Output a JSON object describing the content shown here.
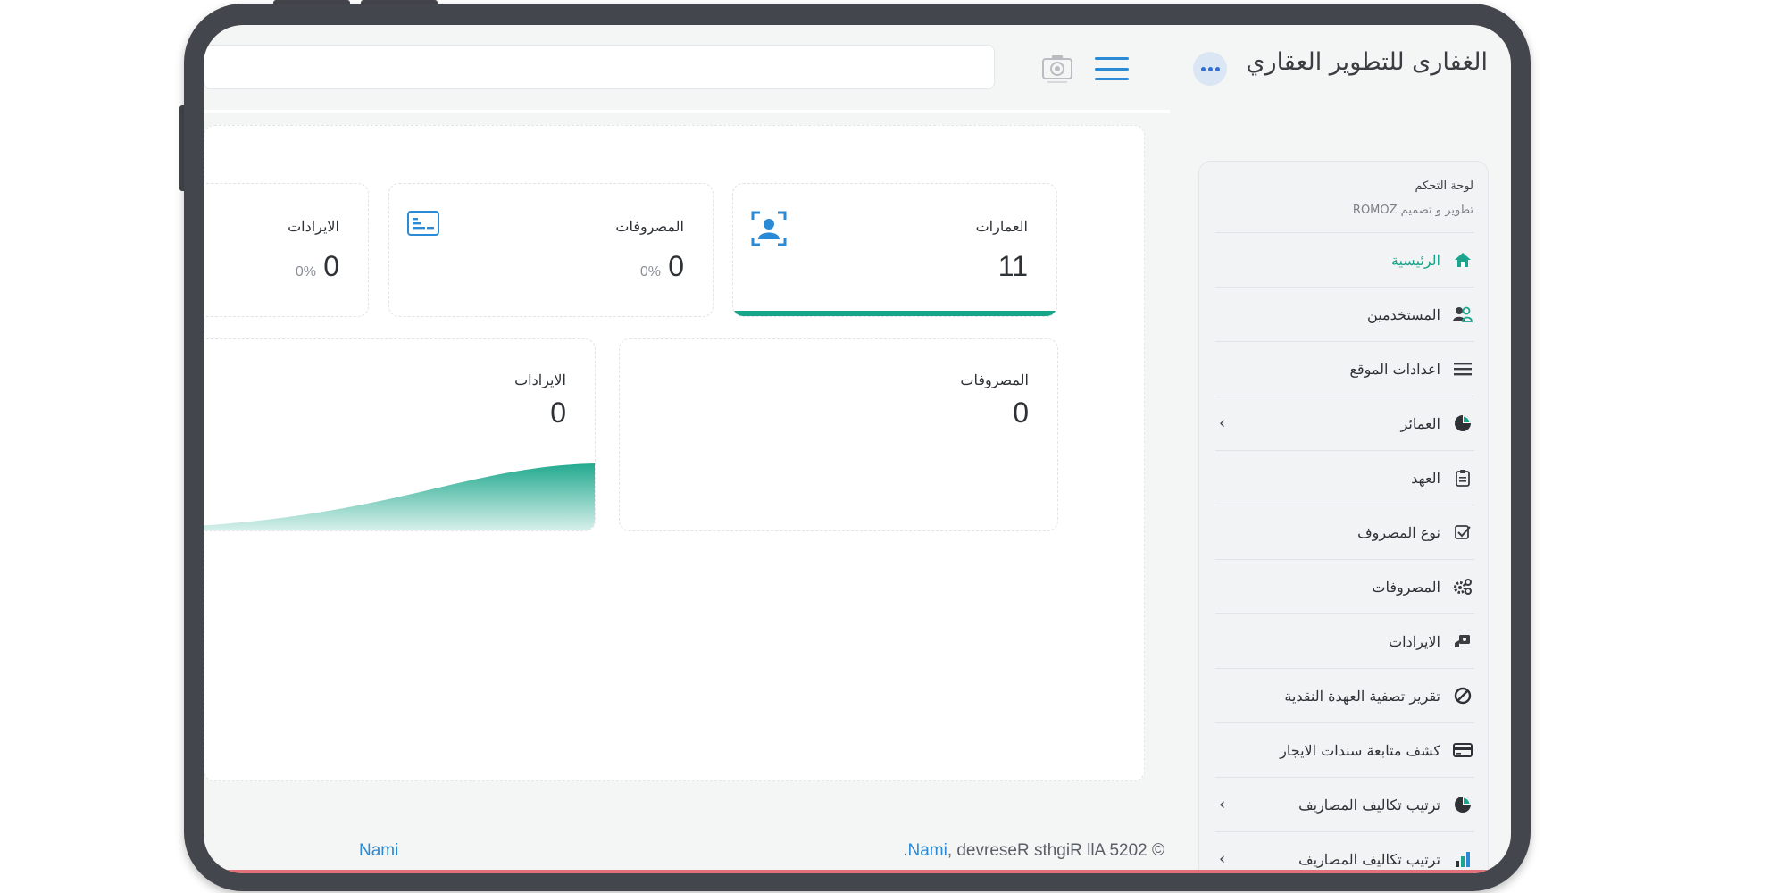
{
  "header": {
    "brand": "الغفارى للتطوير العقاري",
    "more_icon": "more-dots-icon",
    "menu_icon": "hamburger-menu-icon",
    "camera_icon": "camera-icon",
    "search_placeholder": ""
  },
  "sidebar": {
    "heading": "لوحة التحكم",
    "subheading": "تطوير و تصميم ROMOZ",
    "items": [
      {
        "label": "الرئيسية",
        "icon": "home-icon",
        "active": true,
        "chevron": false
      },
      {
        "label": "المستخدمين",
        "icon": "users-icon",
        "active": false,
        "chevron": false
      },
      {
        "label": "اعدادات الموقع",
        "icon": "list-icon",
        "active": false,
        "chevron": false
      },
      {
        "label": "العمائر",
        "icon": "pie-chart-icon",
        "active": false,
        "chevron": true
      },
      {
        "label": "العهد",
        "icon": "clipboard-icon",
        "active": false,
        "chevron": false
      },
      {
        "label": "نوع المصروف",
        "icon": "checkbox-icon",
        "active": false,
        "chevron": false
      },
      {
        "label": "المصروفات",
        "icon": "gears-icon",
        "active": false,
        "chevron": false
      },
      {
        "label": "الايرادات",
        "icon": "money-icon",
        "active": false,
        "chevron": false
      },
      {
        "label": "تقرير تصفية العهدة النقدية",
        "icon": "ban-icon",
        "active": false,
        "chevron": false
      },
      {
        "label": "كشف متابعة سندات الايجار",
        "icon": "card-icon",
        "active": false,
        "chevron": false
      },
      {
        "label": "ترتيب تكاليف المصاريف",
        "icon": "pie-chart-icon",
        "active": false,
        "chevron": true
      },
      {
        "label": "ترتيب تكاليف المصاريف",
        "icon": "bar-chart-icon",
        "active": false,
        "chevron": true
      }
    ]
  },
  "stats": [
    {
      "title": "العمارات",
      "value": "11",
      "icon": "user-scan-icon"
    },
    {
      "title": "المصروفات",
      "value": "0",
      "pct": "0%",
      "icon": "card-list-icon"
    },
    {
      "title": "الايرادات",
      "value": "0",
      "pct": "0%"
    }
  ],
  "charts": [
    {
      "title": "المصروفات",
      "value": "0"
    },
    {
      "title": "الايرادات",
      "value": "0"
    }
  ],
  "footer": {
    "link": "Nami",
    "copyright_prefix": "© 2025 All Rights Reserved ,",
    "copyright_brand": "Nami",
    "copyright_suffix": "."
  },
  "colors": {
    "accent": "#17a589",
    "link": "#2b8ad6",
    "frame": "#43464c"
  }
}
